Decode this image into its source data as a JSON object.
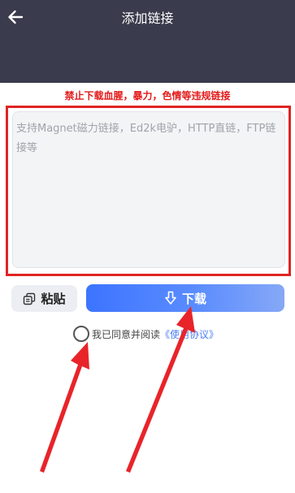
{
  "header": {
    "title": "添加链接",
    "back_icon": "arrow-left-icon",
    "background": "#3a3b4c"
  },
  "warning": {
    "text": "禁止下载血腥，暴力，色情等违规链接",
    "color": "#e31b1b"
  },
  "link_input": {
    "value": "",
    "placeholder": "支持Magnet磁力链接，Ed2k电驴，HTTP直链，FTP链接等"
  },
  "actions": {
    "paste_label": "粘贴",
    "paste_icon": "copy-icon",
    "download_label": "下载",
    "download_icon": "download-arrow-icon",
    "download_color": "#3d74ff"
  },
  "agreement": {
    "checked": false,
    "prefix": "我已同意并阅读",
    "link": "《使用协议》",
    "link_color": "#4a7ef2"
  },
  "annotation": {
    "highlight_color": "#e02424",
    "arrow_color": "#e8242a"
  }
}
